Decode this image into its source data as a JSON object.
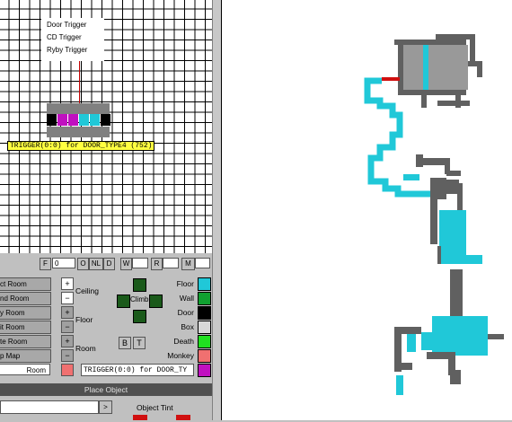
{
  "grid": {
    "legend": [
      "Door Trigger",
      "CD Trigger",
      "Ryby Trigger"
    ],
    "tooltip": "TRIGGER(0:0) for DOOR_TYPE4 (752)"
  },
  "toolbar": {
    "f_label": "F",
    "f_value": "0",
    "o_label": "O",
    "nl_label": "NL",
    "d_label": "D",
    "w_label": "W",
    "r_label": "R",
    "m_label": "M"
  },
  "rooms": [
    "ct Room",
    "nd Room",
    "y Room",
    "it Room",
    "te Room",
    "p Map",
    "Room"
  ],
  "controls": {
    "plus": "+",
    "minus": "−",
    "ceiling": "Ceiling",
    "floor": "Floor",
    "room": "Room",
    "climb": "Climb",
    "b_label": "B",
    "t_label": "T",
    "trigger_field": "TRIGGER(0:0) for DOOR_TY"
  },
  "colors": [
    {
      "label": "Floor",
      "color": "#20c8d8"
    },
    {
      "label": "Wall",
      "color": "#10a030"
    },
    {
      "label": "Door",
      "color": "#000000"
    },
    {
      "label": "Box",
      "color": "#d8d8d8"
    },
    {
      "label": "Death",
      "color": "#20e020"
    },
    {
      "label": "Monkey",
      "color": "#f07070"
    },
    {
      "label": "",
      "color": "#c010c0"
    }
  ],
  "footer": {
    "place_object": "Place Object",
    "object_tint": "Object Tint",
    "arrow": ">"
  }
}
